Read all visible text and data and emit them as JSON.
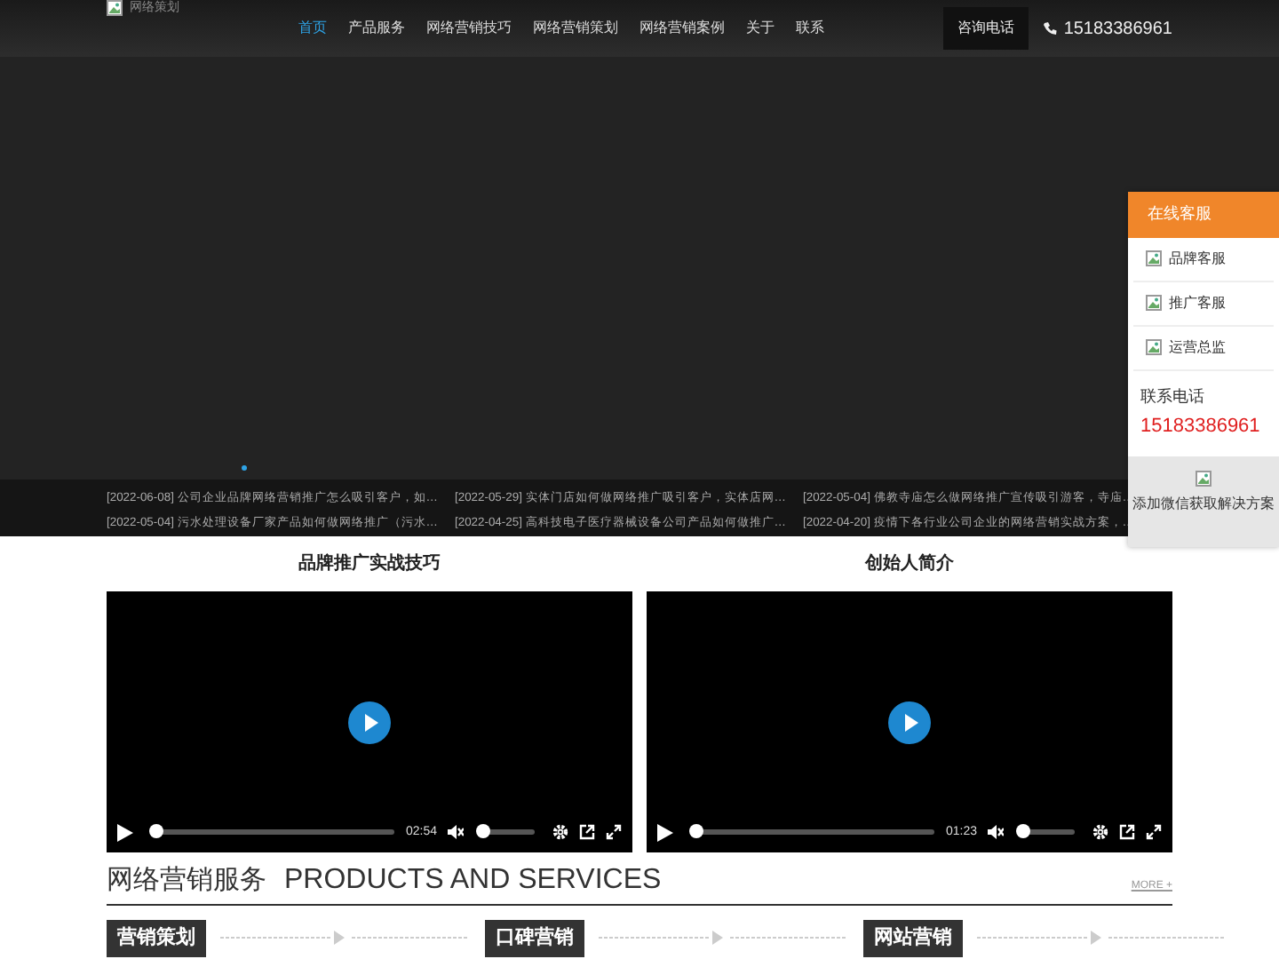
{
  "header": {
    "logo_alt": "网络策划",
    "nav": [
      {
        "label": "首页",
        "selected": true
      },
      {
        "label": "产品服务",
        "selected": false
      },
      {
        "label": "网络营销技巧",
        "selected": false
      },
      {
        "label": "网络营销策划",
        "selected": false
      },
      {
        "label": "网络营销案例",
        "selected": false
      },
      {
        "label": "关于",
        "selected": false
      },
      {
        "label": "联系",
        "selected": false
      }
    ],
    "consult_button": "咨询电话",
    "phone": "15183386961"
  },
  "banner": {
    "dots": [
      {
        "selected": true
      }
    ]
  },
  "news": [
    {
      "text": "[2022-06-08] 公司企业品牌网络营销推广怎么吸引客户，如…"
    },
    {
      "text": "[2022-05-29] 实体门店如何做网络推广吸引客户，实体店网…"
    },
    {
      "text": "[2022-05-04] 佛教寺庙怎么做网络推广宣传吸引游客，寺庙…"
    },
    {
      "text": "[2022-05-04] 污水处理设备厂家产品如何做网络推广（污水…"
    },
    {
      "text": "[2022-04-25] 高科技电子医疗器械设备公司产品如何做推广…"
    },
    {
      "text": "[2022-04-20] 疫情下各行业公司企业的网络营销实战方案，…"
    }
  ],
  "service_panel": {
    "title": "在线客服",
    "items": [
      {
        "label": "品牌客服"
      },
      {
        "label": "推广客服"
      },
      {
        "label": "运营总监"
      }
    ],
    "phone_label": "联系电话",
    "phone": "15183386961",
    "wechat_caption": "添加微信获取解决方案"
  },
  "videos": [
    {
      "title": "品牌推广实战技巧",
      "duration": "02:54",
      "muted": true,
      "progress": {
        "level": 0
      },
      "volume": {
        "level": 0
      }
    },
    {
      "title": "创始人简介",
      "duration": "01:23",
      "muted": true,
      "progress": {
        "level": 0
      },
      "volume": {
        "level": 0
      }
    }
  ],
  "services": {
    "title": "网络营销服务",
    "subtitle": "PRODUCTS AND SERVICES",
    "more": "MORE +",
    "items": [
      {
        "label": "营销策划"
      },
      {
        "label": "口碑营销"
      },
      {
        "label": "网站营销"
      }
    ]
  }
}
